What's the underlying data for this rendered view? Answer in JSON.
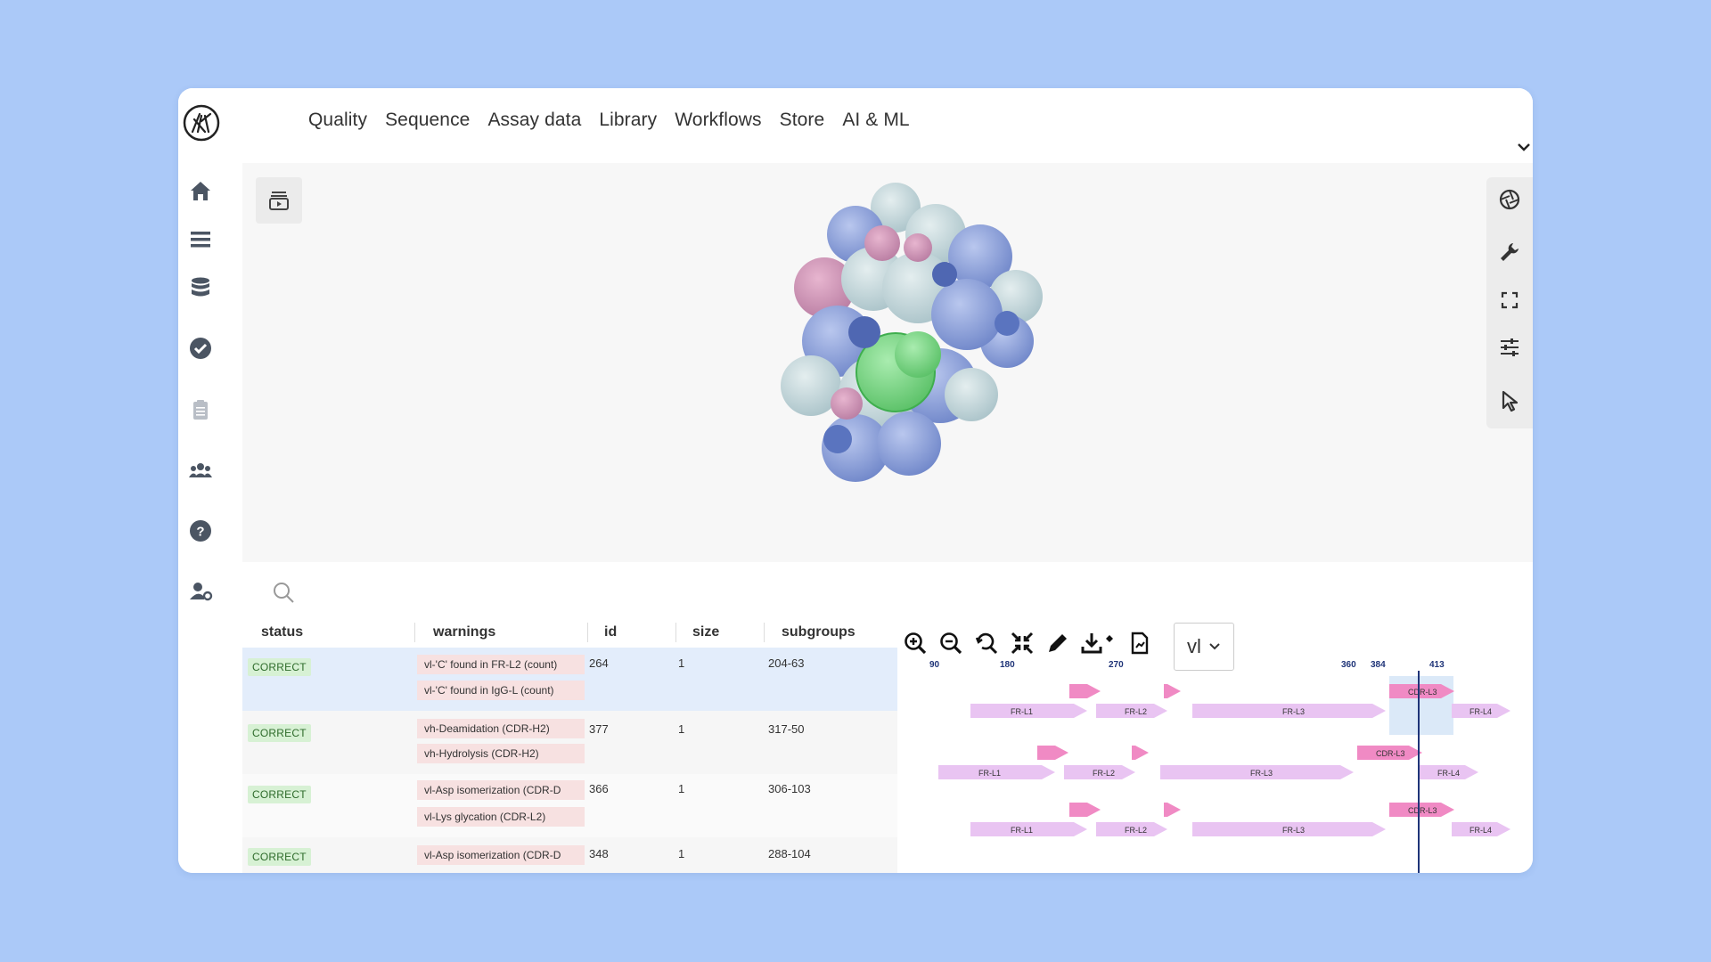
{
  "nav": {
    "items": [
      "Quality",
      "Sequence",
      "Assay data",
      "Library",
      "Workflows",
      "Store",
      "AI & ML"
    ]
  },
  "sidebar": {
    "icons": [
      "home-icon",
      "menu-icon",
      "database-icon",
      "check-circle-icon",
      "clipboard-icon",
      "users-icon",
      "help-icon",
      "user-settings-icon"
    ]
  },
  "viewer": {
    "right_tools": [
      "camera-aperture-icon",
      "wrench-icon",
      "fullscreen-icon",
      "sliders-icon",
      "pointer-icon"
    ]
  },
  "table": {
    "headers": {
      "status": "status",
      "warnings": "warnings",
      "id": "id",
      "size": "size",
      "subgroups": "subgroups"
    },
    "rows": [
      {
        "status": "CORRECT",
        "warnings": [
          "vl-'C' found in FR-L2 (count)",
          "vl-'C' found in IgG-L (count)"
        ],
        "id": "264",
        "size": "1",
        "subgroups": "204-63",
        "selected": true
      },
      {
        "status": "CORRECT",
        "warnings": [
          "vh-Deamidation (CDR-H2)",
          "vh-Hydrolysis (CDR-H2)"
        ],
        "id": "377",
        "size": "1",
        "subgroups": "317-50"
      },
      {
        "status": "CORRECT",
        "warnings": [
          "vl-Asp isomerization (CDR-D",
          "vl-Lys glycation (CDR-L2)"
        ],
        "id": "366",
        "size": "1",
        "subgroups": "306-103"
      },
      {
        "status": "CORRECT",
        "warnings": [
          "vl-Asp isomerization (CDR-D"
        ],
        "id": "348",
        "size": "1",
        "subgroups": "288-104"
      }
    ]
  },
  "sequence": {
    "chain": "vl",
    "positions": [
      "90",
      "180",
      "270",
      "360",
      "384",
      "413"
    ],
    "region_labels": [
      "FR-L1",
      "FR-L2",
      "FR-L3",
      "CDR-L3",
      "FR-L4"
    ],
    "colors": {
      "framework": "#e9c4f2",
      "cdr": "#f08ac4",
      "cursor": "#1f3478",
      "highlight": "#e3edfb"
    }
  }
}
